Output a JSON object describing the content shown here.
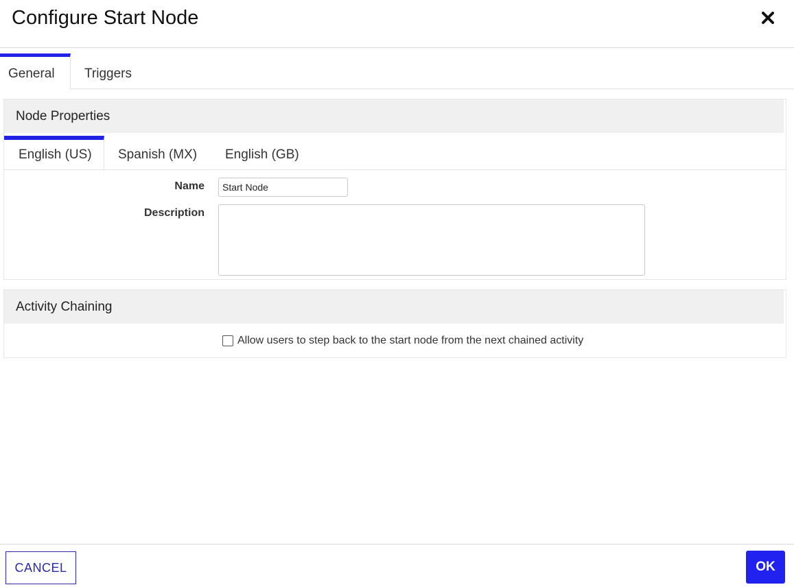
{
  "dialog": {
    "title": "Configure Start Node",
    "close_icon": "close-x-icon"
  },
  "main_tabs": [
    {
      "label": "General",
      "active": true
    },
    {
      "label": "Triggers",
      "active": false
    }
  ],
  "node_properties": {
    "title": "Node Properties",
    "language_tabs": [
      {
        "label": "English (US)",
        "active": true
      },
      {
        "label": "Spanish (MX)",
        "active": false
      },
      {
        "label": "English (GB)",
        "active": false
      }
    ],
    "name_label": "Name",
    "name_value": "Start Node",
    "description_label": "Description",
    "description_value": ""
  },
  "activity_chaining": {
    "title": "Activity Chaining",
    "step_back_label": "Allow users to step back to the start node from the next chained activity",
    "step_back_checked": false
  },
  "footer": {
    "cancel_label": "CANCEL",
    "ok_label": "OK"
  },
  "colors": {
    "accent": "#2222e6",
    "ok_button": "#2121f0",
    "cancel_text": "#2a2aa8",
    "section_header_bg": "#f0f0f0"
  }
}
